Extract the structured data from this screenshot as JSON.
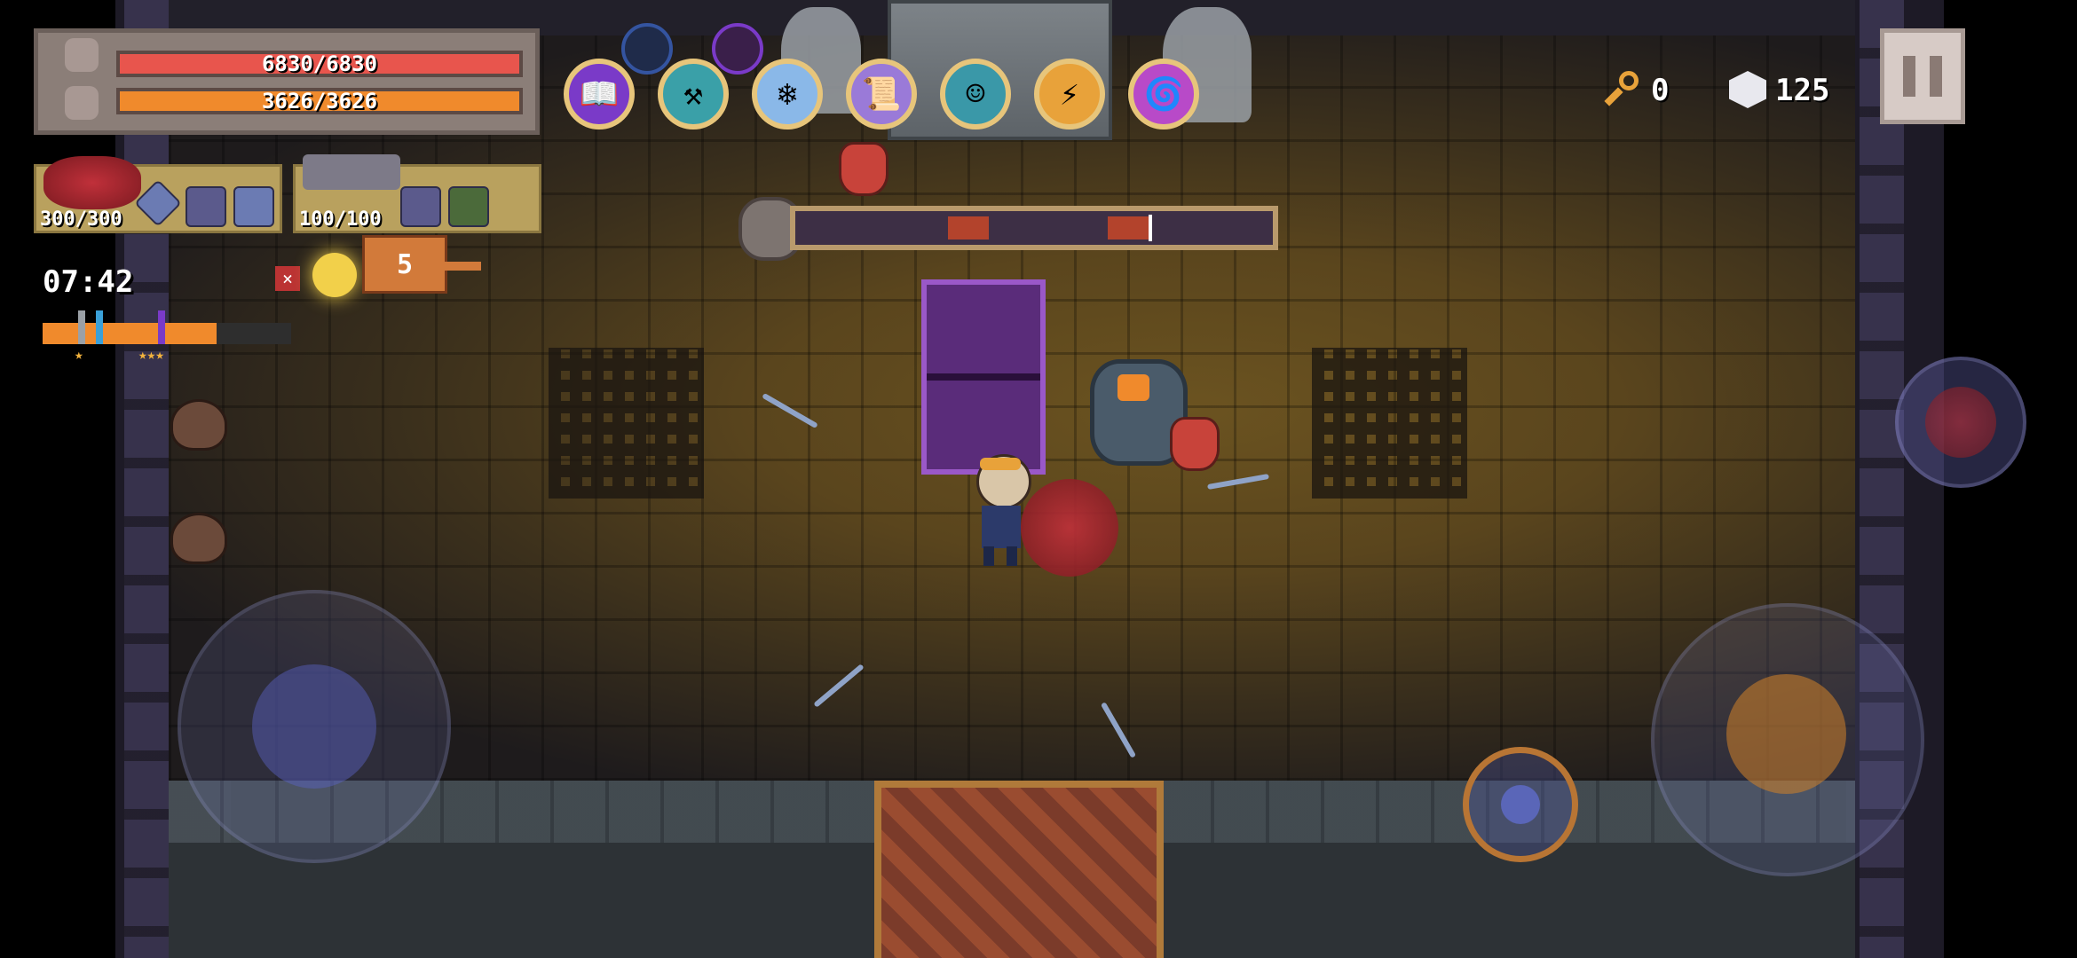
{
  "hud": {
    "health": {
      "text": "6830/6830",
      "current": 6830,
      "max": 6830,
      "color": "#e8554d"
    },
    "armor": {
      "text": "3626/3626",
      "current": 3626,
      "max": 3626,
      "color": "#f08a2c"
    },
    "weapon1": {
      "ammo": "300/300"
    },
    "weapon2": {
      "ammo": "100/100"
    },
    "timer": "07:42",
    "progress_fraction": 0.7,
    "keys": "0",
    "gems": "125",
    "boss_health_fraction": 0.5
  },
  "skills": [
    {
      "name": "purple-book-skill",
      "icon": "📖"
    },
    {
      "name": "hammer-skill",
      "icon": "⚒"
    },
    {
      "name": "ice-dash-skill",
      "icon": "❄"
    },
    {
      "name": "scroll-skill",
      "icon": "📜"
    },
    {
      "name": "robot-head-skill",
      "icon": "☺"
    },
    {
      "name": "golden-blade-skill",
      "icon": "⚡"
    },
    {
      "name": "vortex-skill",
      "icon": "🌀"
    }
  ],
  "icons": {
    "pet_badge": "5",
    "close": "×",
    "stars_left": "★",
    "stars_right": "★★★"
  }
}
